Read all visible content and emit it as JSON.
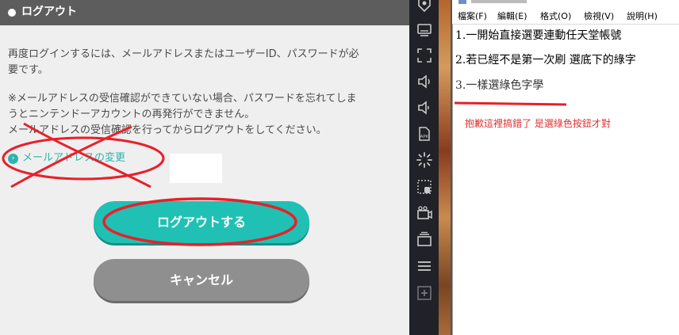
{
  "dialog": {
    "title": "ログアウト",
    "para1_line1": "再度ログインするには、メールアドレスまたはユーザーID、パスワードが必",
    "para1_line2": "要です。",
    "para2_line1": "※メールアドレスの受信確認ができていない場合、パスワードを忘れてしま",
    "para2_line2": "うとニンテンドーアカウントの再発行ができません。",
    "para3": "メールアドレスの受信確認を行ってからログアウトをしてください。",
    "change_email_link": "メールアドレスの変更",
    "logout_button": "ログアウトする",
    "cancel_button": "キャンセル"
  },
  "toolbar": {
    "icons": [
      "location-icon",
      "keyboard-icon",
      "fullscreen-icon",
      "volume-up-icon",
      "volume-down-icon",
      "apk-install-icon",
      "loading-icon",
      "screen-record-icon",
      "video-record-icon",
      "multi-instance-icon",
      "menu-icon",
      "add-icon"
    ]
  },
  "notepad": {
    "menu": [
      "檔案(F)",
      "編輯(E)",
      "格式(O)",
      "檢視(V)",
      "說明(H)"
    ],
    "line1": "1.一開始直接選要連動任天堂帳號",
    "line2": "2.若已經不是第一次刷 選底下的綠字",
    "line3": "3.一樣選綠色字學",
    "note": "抱歉這裡搞錯了 是選綠色按鈕才對"
  },
  "annotation_color": "#e8202a",
  "accent_teal": "#20c1b4"
}
